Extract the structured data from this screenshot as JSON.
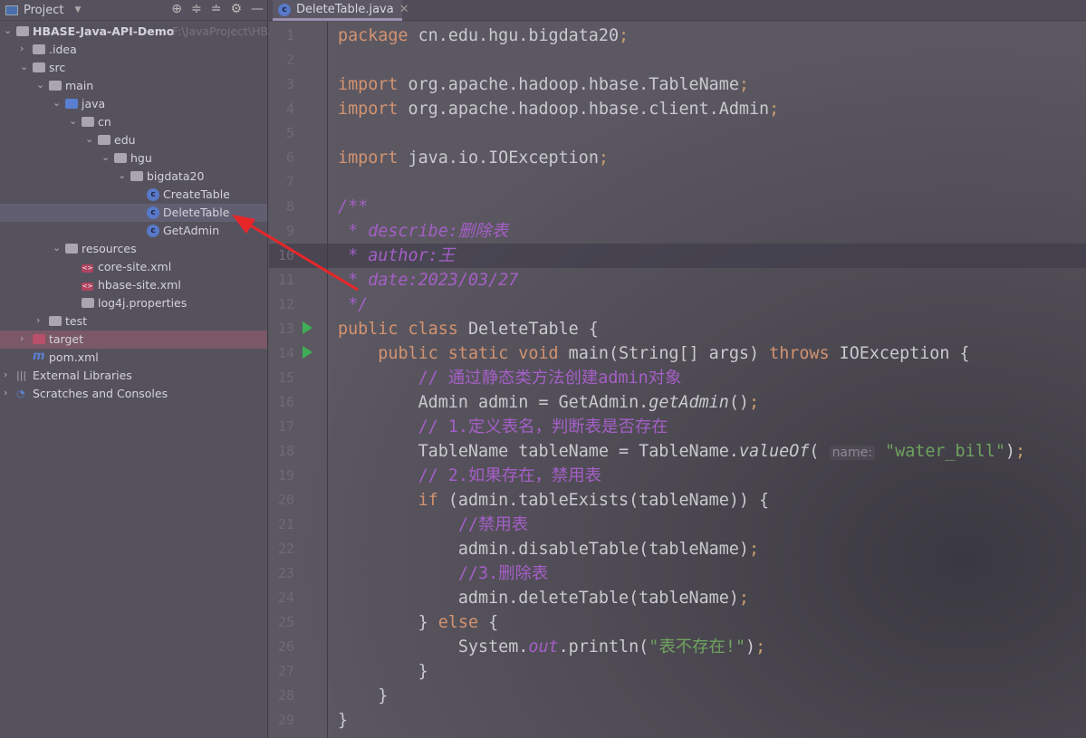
{
  "sidebar": {
    "title": "Project",
    "icons": [
      "locate-icon",
      "expand-all-icon",
      "collapse-all-icon",
      "gear-icon",
      "minimize-icon"
    ],
    "tree": [
      {
        "label": "HBASE-Java-API-Demo",
        "path": "F:\\JavaProject\\HBASE",
        "level": 0,
        "type": "module",
        "open": true,
        "bold": true
      },
      {
        "label": ".idea",
        "level": 1,
        "type": "folder",
        "open": false
      },
      {
        "label": "src",
        "level": 1,
        "type": "folder",
        "open": true
      },
      {
        "label": "main",
        "level": 2,
        "type": "folder",
        "open": true
      },
      {
        "label": "java",
        "level": 3,
        "type": "folder-blue",
        "open": true
      },
      {
        "label": "cn",
        "level": 4,
        "type": "package",
        "open": true
      },
      {
        "label": "edu",
        "level": 5,
        "type": "package",
        "open": true
      },
      {
        "label": "hgu",
        "level": 6,
        "type": "package",
        "open": true
      },
      {
        "label": "bigdata20",
        "level": 7,
        "type": "package",
        "open": true
      },
      {
        "label": "CreateTable",
        "level": 8,
        "type": "class"
      },
      {
        "label": "DeleteTable",
        "level": 8,
        "type": "class",
        "selected": true
      },
      {
        "label": "GetAdmin",
        "level": 8,
        "type": "class"
      },
      {
        "label": "resources",
        "level": 3,
        "type": "folder",
        "open": true
      },
      {
        "label": "core-site.xml",
        "level": 4,
        "type": "xml"
      },
      {
        "label": "hbase-site.xml",
        "level": 4,
        "type": "xml"
      },
      {
        "label": "log4j.properties",
        "level": 4,
        "type": "props"
      },
      {
        "label": "test",
        "level": 2,
        "type": "folder",
        "open": false
      },
      {
        "label": "target",
        "level": 1,
        "type": "folder-red",
        "open": false,
        "excluded": true
      },
      {
        "label": "pom.xml",
        "level": 1,
        "type": "maven"
      },
      {
        "label": "External Libraries",
        "level": 0,
        "type": "libs",
        "open": false
      },
      {
        "label": "Scratches and Consoles",
        "level": 0,
        "type": "scratch",
        "open": false
      }
    ]
  },
  "editor": {
    "tab": "DeleteTable.java",
    "current_line": 10,
    "lines": [
      [
        [
          "kw",
          "package "
        ],
        [
          "",
          "cn.edu.hgu.bigdata20"
        ],
        [
          "sc",
          ";"
        ]
      ],
      [],
      [
        [
          "kw",
          "import "
        ],
        [
          "",
          "org.apache.hadoop.hbase.TableName"
        ],
        [
          "sc",
          ";"
        ]
      ],
      [
        [
          "kw",
          "import "
        ],
        [
          "",
          "org.apache.hadoop.hbase.client.Admin"
        ],
        [
          "sc",
          ";"
        ]
      ],
      [],
      [
        [
          "kw",
          "import "
        ],
        [
          "",
          "java.io.IOException"
        ],
        [
          "sc",
          ";"
        ]
      ],
      [],
      [
        [
          "cmi",
          "/**"
        ]
      ],
      [
        [
          "cmi",
          " * describe:删除表"
        ]
      ],
      [
        [
          "cmi",
          " * author:王"
        ]
      ],
      [
        [
          "cmi",
          " * date:2023/03/27"
        ]
      ],
      [
        [
          "cmi",
          " */"
        ]
      ],
      [
        [
          "kw",
          "public class "
        ],
        [
          "",
          "DeleteTable {"
        ]
      ],
      [
        [
          "",
          "    "
        ],
        [
          "kw",
          "public static void "
        ],
        [
          "",
          "main(String[] args) "
        ],
        [
          "kw",
          "throws "
        ],
        [
          "",
          "IOException {"
        ]
      ],
      [
        [
          "cm",
          "        // 通过静态类方法创建admin对象"
        ]
      ],
      [
        [
          "",
          "        Admin admin = GetAdmin."
        ],
        [
          "it",
          "getAdmin"
        ],
        [
          "",
          "()"
        ],
        [
          "sc",
          ";"
        ]
      ],
      [
        [
          "cm",
          "        // 1.定义表名，判断表是否存在"
        ]
      ],
      [
        [
          "",
          "        TableName tableName = TableName."
        ],
        [
          "it",
          "valueOf"
        ],
        [
          "",
          "( "
        ],
        [
          "hint",
          "name:"
        ],
        [
          "str",
          " \"water_bill\""
        ],
        [
          "",
          ")"
        ],
        [
          "sc",
          ";"
        ]
      ],
      [
        [
          "cm",
          "        // 2.如果存在，禁用表"
        ]
      ],
      [
        [
          "",
          "        "
        ],
        [
          "kw",
          "if "
        ],
        [
          "",
          "(admin.tableExists(tableName)) {"
        ]
      ],
      [
        [
          "cm",
          "            //禁用表"
        ]
      ],
      [
        [
          "",
          "            admin.disableTable(tableName)"
        ],
        [
          "sc",
          ";"
        ]
      ],
      [
        [
          "cm",
          "            //3.删除表"
        ]
      ],
      [
        [
          "",
          "            admin.deleteTable(tableName)"
        ],
        [
          "sc",
          ";"
        ]
      ],
      [
        [
          "",
          "        } "
        ],
        [
          "kw",
          "else "
        ],
        [
          "",
          "{"
        ]
      ],
      [
        [
          "",
          "            System."
        ],
        [
          "cmi",
          "out"
        ],
        [
          "",
          ".println("
        ],
        [
          "str",
          "\"表不存在!\""
        ],
        [
          "",
          ")"
        ],
        [
          "sc",
          ";"
        ]
      ],
      [
        [
          "",
          "        }"
        ]
      ],
      [
        [
          "",
          "    }"
        ]
      ],
      [
        [
          "",
          "}"
        ]
      ]
    ],
    "run_lines": [
      13,
      14
    ]
  },
  "annotation": {
    "color": "#e8262a"
  }
}
